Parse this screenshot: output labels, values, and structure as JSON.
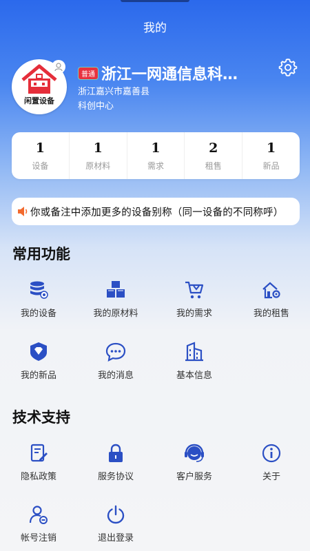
{
  "nav": {
    "title": "我的"
  },
  "profile": {
    "avatar_text": "闲置设备",
    "level": "普通",
    "company": "浙江一网通信息科…",
    "address_line1": "浙江嘉兴市嘉善县",
    "address_line2": "科创中心"
  },
  "stats": [
    {
      "value": "1",
      "label": "设备"
    },
    {
      "value": "1",
      "label": "原材料"
    },
    {
      "value": "1",
      "label": "需求"
    },
    {
      "value": "2",
      "label": "租售"
    },
    {
      "value": "1",
      "label": "新品"
    }
  ],
  "notice": {
    "text": "你或备注中添加更多的设备别称（同一设备的不同称呼）"
  },
  "common": {
    "title": "常用功能",
    "items": [
      {
        "label": "我的设备",
        "icon": "database-icon"
      },
      {
        "label": "我的原材料",
        "icon": "boxes-icon"
      },
      {
        "label": "我的需求",
        "icon": "cart-icon"
      },
      {
        "label": "我的租售",
        "icon": "house-gear-icon"
      },
      {
        "label": "我的新品",
        "icon": "diamond-badge-icon"
      },
      {
        "label": "我的消息",
        "icon": "chat-icon"
      },
      {
        "label": "基本信息",
        "icon": "building-icon"
      }
    ]
  },
  "support": {
    "title": "技术支持",
    "items": [
      {
        "label": "隐私政策",
        "icon": "document-edit-icon"
      },
      {
        "label": "服务协议",
        "icon": "lock-icon"
      },
      {
        "label": "客户服务",
        "icon": "headset-icon"
      },
      {
        "label": "关于",
        "icon": "info-icon"
      },
      {
        "label": "帐号注销",
        "icon": "user-remove-icon"
      },
      {
        "label": "退出登录",
        "icon": "power-icon"
      }
    ]
  },
  "colors": {
    "accent": "#2b4fc4",
    "header": "#2b69ec",
    "tag": "#e8323f"
  }
}
